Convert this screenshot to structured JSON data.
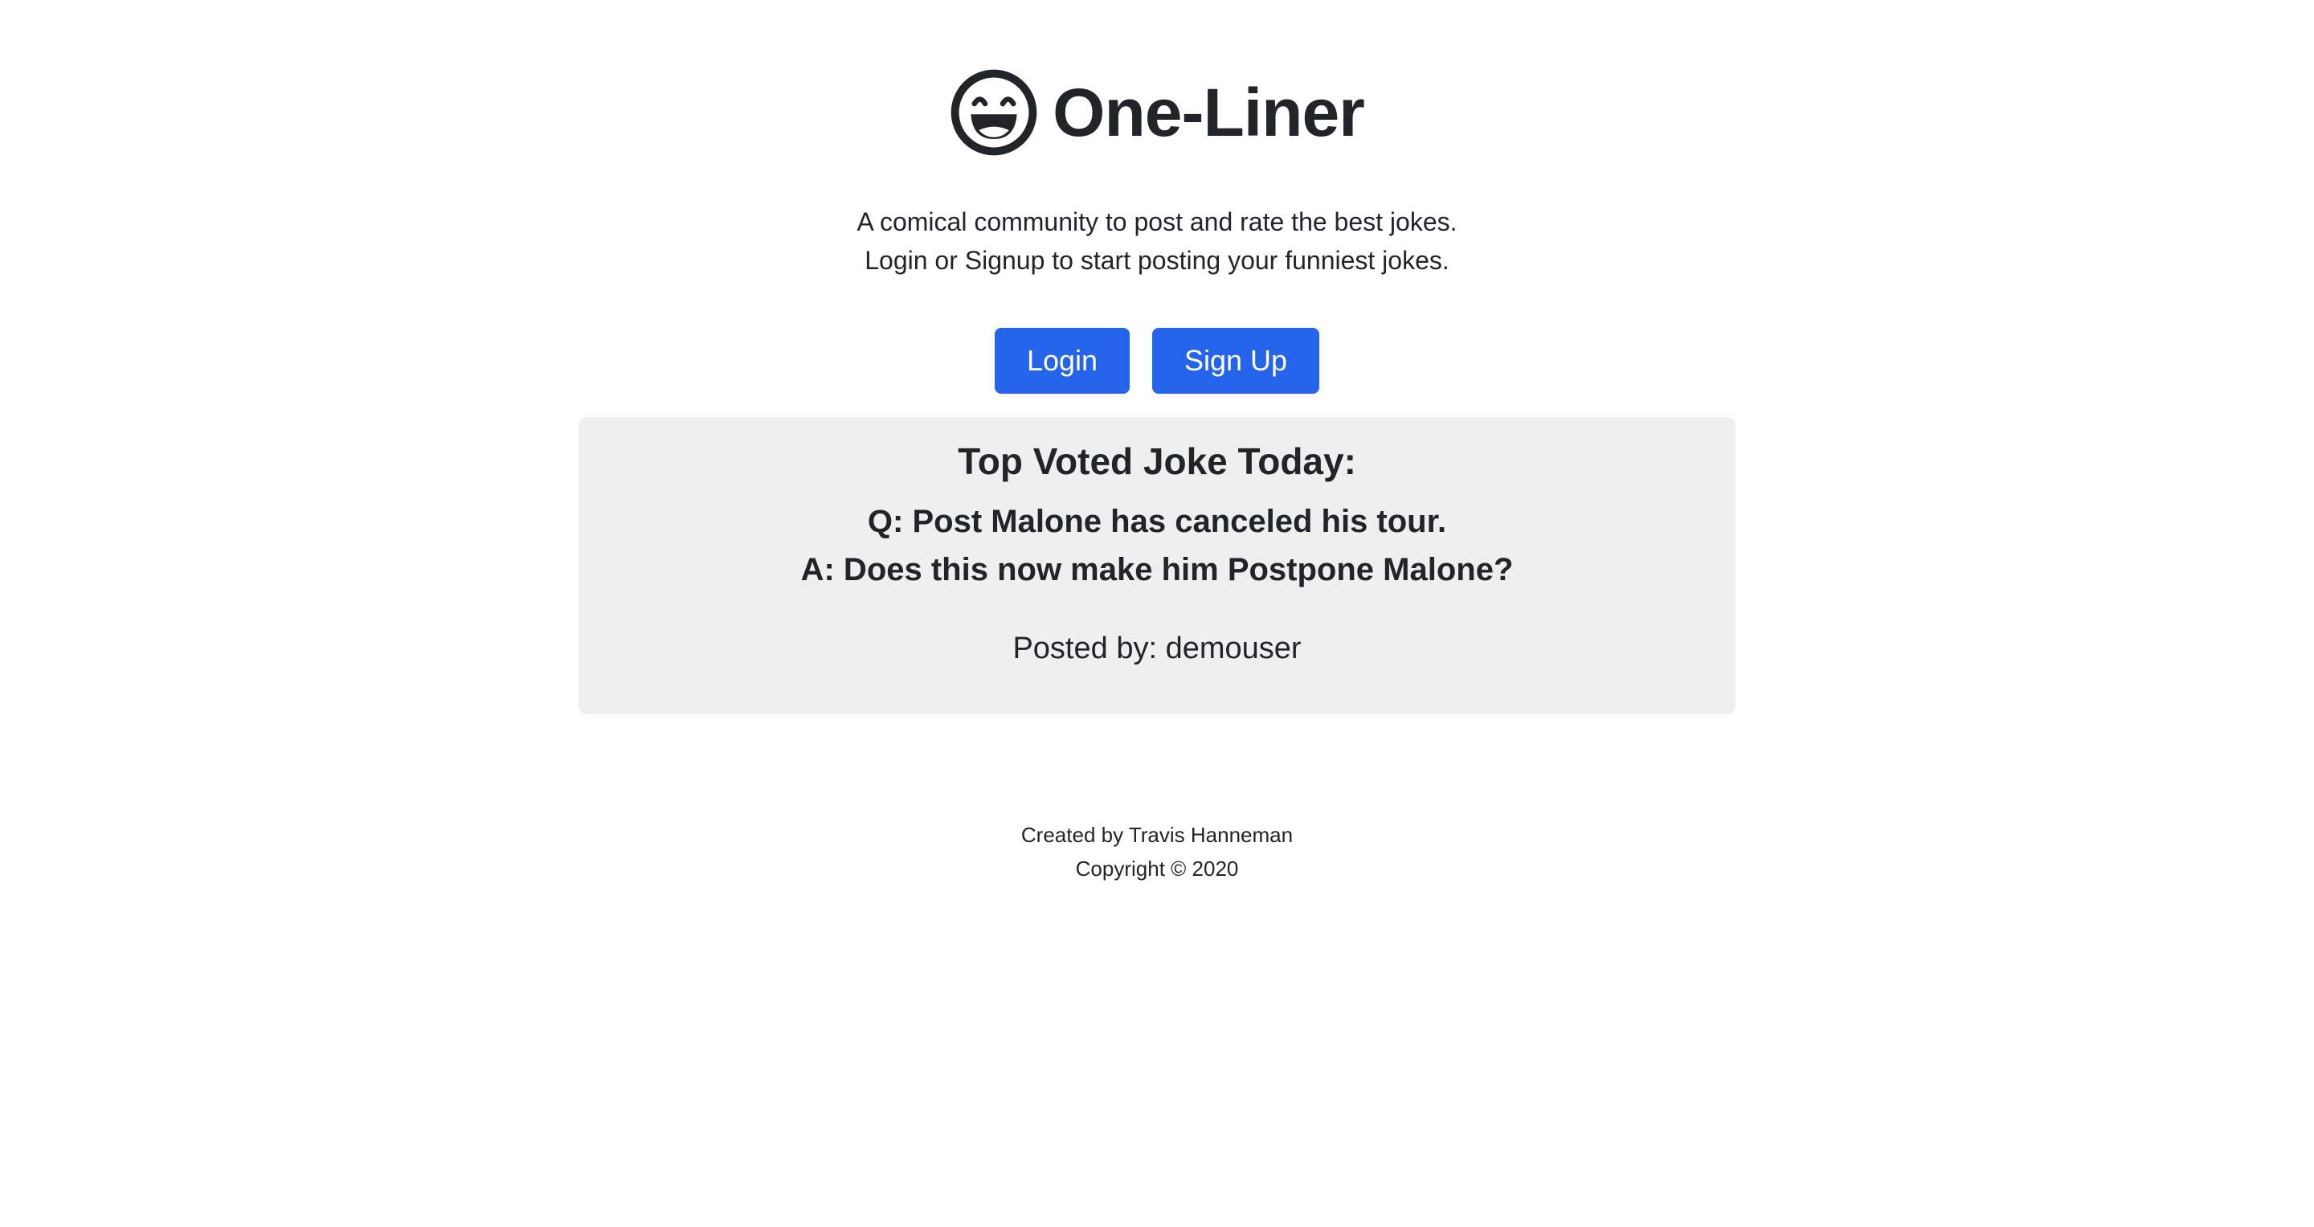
{
  "brand": {
    "icon": "grinning-face-icon",
    "title": "One-Liner"
  },
  "tagline": {
    "line1": "A comical community to post and rate the best jokes.",
    "line2": "Login or Signup to start posting your funniest jokes."
  },
  "actions": {
    "login_label": "Login",
    "signup_label": "Sign Up"
  },
  "top_joke": {
    "heading": "Top Voted Joke Today:",
    "question": "Q: Post Malone has canceled his tour.",
    "answer": "A: Does this now make him Postpone Malone?",
    "posted_by": "Posted by: demouser"
  },
  "footer": {
    "credit": "Created by Travis Hanneman",
    "copyright": "Copyright © 2020"
  },
  "colors": {
    "primary_button": "#2563eb",
    "card_background": "#efefef",
    "text": "#212529"
  }
}
